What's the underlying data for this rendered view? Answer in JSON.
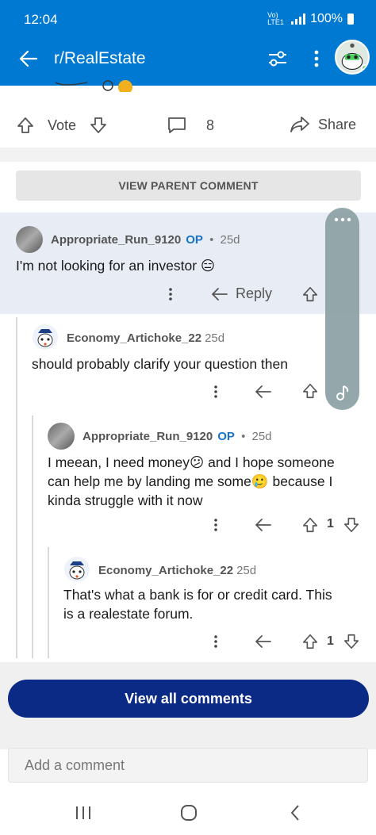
{
  "status": {
    "time": "12:04",
    "network": "Vo) LTE1",
    "battery": "100%"
  },
  "header": {
    "title": "r/RealEstate"
  },
  "post_actions": {
    "vote_label": "Vote",
    "comments_count": "8",
    "share_label": "Share"
  },
  "view_parent_label": "VIEW PARENT COMMENT",
  "comments": [
    {
      "author": "Appropriate_Run_9120",
      "op": "OP",
      "age": "25d",
      "body": "I'm not looking for an investor 😑",
      "reply_label": "Reply",
      "score": ""
    },
    {
      "author": "Economy_Artichoke_22",
      "op": "",
      "age": "25d",
      "body": "should probably clarify your question then",
      "score": ""
    },
    {
      "author": "Appropriate_Run_9120",
      "op": "OP",
      "age": "25d",
      "body_lines": [
        "I meean, I need money😕 and I hope someone",
        "can help me by landing me some🥲  because I",
        "kinda struggle with it now"
      ],
      "score": "1"
    },
    {
      "author": "Economy_Artichoke_22",
      "op": "",
      "age": "25d",
      "body_lines": [
        "That's what a bank is for or credit card. This",
        "is a realestate forum."
      ],
      "score": "1"
    }
  ],
  "view_all_label": "View all comments",
  "add_comment_placeholder": "Add a comment",
  "colors": {
    "header": "#0079d3",
    "view_all": "#0a2a86",
    "op": "#1a73c9"
  }
}
